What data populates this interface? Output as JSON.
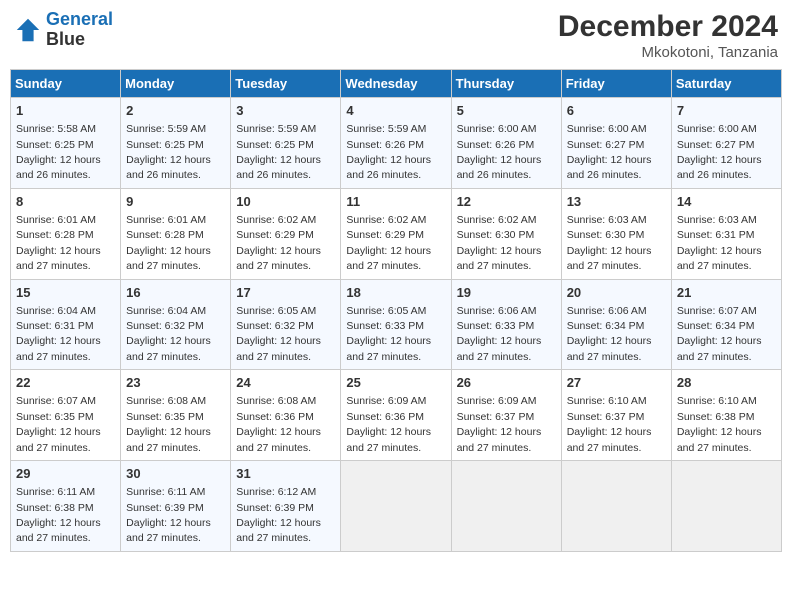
{
  "header": {
    "logo_line1": "General",
    "logo_line2": "Blue",
    "month": "December 2024",
    "location": "Mkokotoni, Tanzania"
  },
  "weekdays": [
    "Sunday",
    "Monday",
    "Tuesday",
    "Wednesday",
    "Thursday",
    "Friday",
    "Saturday"
  ],
  "weeks": [
    [
      {
        "day": "1",
        "sunrise": "5:58 AM",
        "sunset": "6:25 PM",
        "daylight": "12 hours and 26 minutes."
      },
      {
        "day": "2",
        "sunrise": "5:59 AM",
        "sunset": "6:25 PM",
        "daylight": "12 hours and 26 minutes."
      },
      {
        "day": "3",
        "sunrise": "5:59 AM",
        "sunset": "6:25 PM",
        "daylight": "12 hours and 26 minutes."
      },
      {
        "day": "4",
        "sunrise": "5:59 AM",
        "sunset": "6:26 PM",
        "daylight": "12 hours and 26 minutes."
      },
      {
        "day": "5",
        "sunrise": "6:00 AM",
        "sunset": "6:26 PM",
        "daylight": "12 hours and 26 minutes."
      },
      {
        "day": "6",
        "sunrise": "6:00 AM",
        "sunset": "6:27 PM",
        "daylight": "12 hours and 26 minutes."
      },
      {
        "day": "7",
        "sunrise": "6:00 AM",
        "sunset": "6:27 PM",
        "daylight": "12 hours and 26 minutes."
      }
    ],
    [
      {
        "day": "8",
        "sunrise": "6:01 AM",
        "sunset": "6:28 PM",
        "daylight": "12 hours and 27 minutes."
      },
      {
        "day": "9",
        "sunrise": "6:01 AM",
        "sunset": "6:28 PM",
        "daylight": "12 hours and 27 minutes."
      },
      {
        "day": "10",
        "sunrise": "6:02 AM",
        "sunset": "6:29 PM",
        "daylight": "12 hours and 27 minutes."
      },
      {
        "day": "11",
        "sunrise": "6:02 AM",
        "sunset": "6:29 PM",
        "daylight": "12 hours and 27 minutes."
      },
      {
        "day": "12",
        "sunrise": "6:02 AM",
        "sunset": "6:30 PM",
        "daylight": "12 hours and 27 minutes."
      },
      {
        "day": "13",
        "sunrise": "6:03 AM",
        "sunset": "6:30 PM",
        "daylight": "12 hours and 27 minutes."
      },
      {
        "day": "14",
        "sunrise": "6:03 AM",
        "sunset": "6:31 PM",
        "daylight": "12 hours and 27 minutes."
      }
    ],
    [
      {
        "day": "15",
        "sunrise": "6:04 AM",
        "sunset": "6:31 PM",
        "daylight": "12 hours and 27 minutes."
      },
      {
        "day": "16",
        "sunrise": "6:04 AM",
        "sunset": "6:32 PM",
        "daylight": "12 hours and 27 minutes."
      },
      {
        "day": "17",
        "sunrise": "6:05 AM",
        "sunset": "6:32 PM",
        "daylight": "12 hours and 27 minutes."
      },
      {
        "day": "18",
        "sunrise": "6:05 AM",
        "sunset": "6:33 PM",
        "daylight": "12 hours and 27 minutes."
      },
      {
        "day": "19",
        "sunrise": "6:06 AM",
        "sunset": "6:33 PM",
        "daylight": "12 hours and 27 minutes."
      },
      {
        "day": "20",
        "sunrise": "6:06 AM",
        "sunset": "6:34 PM",
        "daylight": "12 hours and 27 minutes."
      },
      {
        "day": "21",
        "sunrise": "6:07 AM",
        "sunset": "6:34 PM",
        "daylight": "12 hours and 27 minutes."
      }
    ],
    [
      {
        "day": "22",
        "sunrise": "6:07 AM",
        "sunset": "6:35 PM",
        "daylight": "12 hours and 27 minutes."
      },
      {
        "day": "23",
        "sunrise": "6:08 AM",
        "sunset": "6:35 PM",
        "daylight": "12 hours and 27 minutes."
      },
      {
        "day": "24",
        "sunrise": "6:08 AM",
        "sunset": "6:36 PM",
        "daylight": "12 hours and 27 minutes."
      },
      {
        "day": "25",
        "sunrise": "6:09 AM",
        "sunset": "6:36 PM",
        "daylight": "12 hours and 27 minutes."
      },
      {
        "day": "26",
        "sunrise": "6:09 AM",
        "sunset": "6:37 PM",
        "daylight": "12 hours and 27 minutes."
      },
      {
        "day": "27",
        "sunrise": "6:10 AM",
        "sunset": "6:37 PM",
        "daylight": "12 hours and 27 minutes."
      },
      {
        "day": "28",
        "sunrise": "6:10 AM",
        "sunset": "6:38 PM",
        "daylight": "12 hours and 27 minutes."
      }
    ],
    [
      {
        "day": "29",
        "sunrise": "6:11 AM",
        "sunset": "6:38 PM",
        "daylight": "12 hours and 27 minutes."
      },
      {
        "day": "30",
        "sunrise": "6:11 AM",
        "sunset": "6:39 PM",
        "daylight": "12 hours and 27 minutes."
      },
      {
        "day": "31",
        "sunrise": "6:12 AM",
        "sunset": "6:39 PM",
        "daylight": "12 hours and 27 minutes."
      },
      null,
      null,
      null,
      null
    ]
  ]
}
